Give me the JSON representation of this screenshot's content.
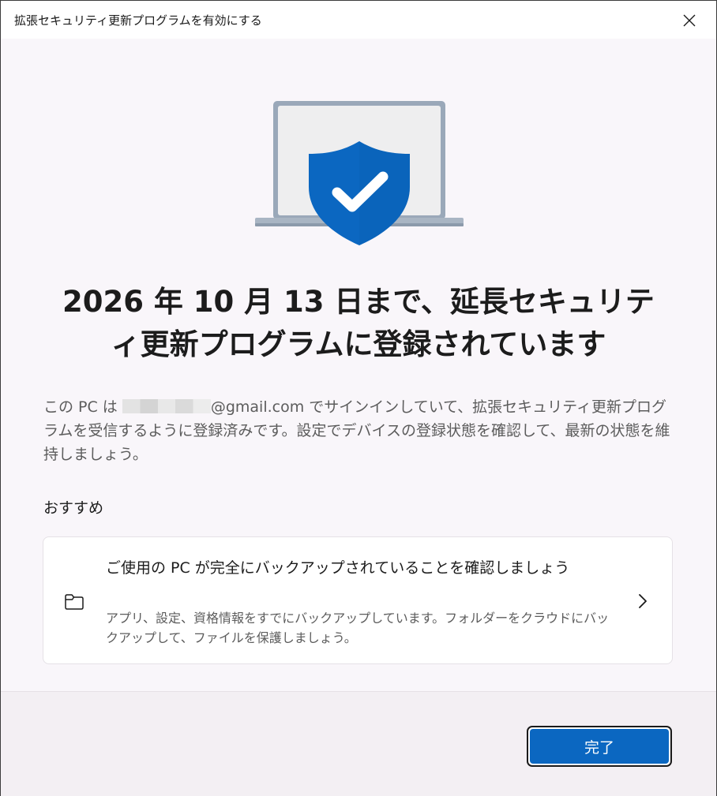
{
  "window": {
    "title": "拡張セキュリティ更新プログラムを有効にする",
    "close_icon": "close-icon"
  },
  "hero": {
    "icon": "laptop-shield-check-icon",
    "colors": {
      "shield": "#0b67c1",
      "laptop": "#9aa8b9"
    }
  },
  "headline": {
    "line1": "2026 年 10 月 13 日まで、延長セキュリテ",
    "line2": "ィ更新プログラムに登録されています"
  },
  "description": {
    "before_email": "この PC は ",
    "email_domain": "@gmail.com",
    "after_email": " でサインインしていて、拡張セキュリティ更新プログラムを受信するように登録済みです。設定でデバイスの登録状態を確認して、最新の状態を維持しましょう。"
  },
  "recommendations": {
    "heading": "おすすめ",
    "items": [
      {
        "icon": "folder-icon",
        "title": "ご使用の PC が完全にバックアップされていることを確認しましょう",
        "description": "アプリ、設定、資格情報をすでにバックアップしています。フォルダーをクラウドにバックアップして、ファイルを保護しましょう。",
        "chevron": "chevron-right-icon"
      }
    ]
  },
  "footer": {
    "done_label": "完了",
    "accent": "#0b67c1"
  }
}
